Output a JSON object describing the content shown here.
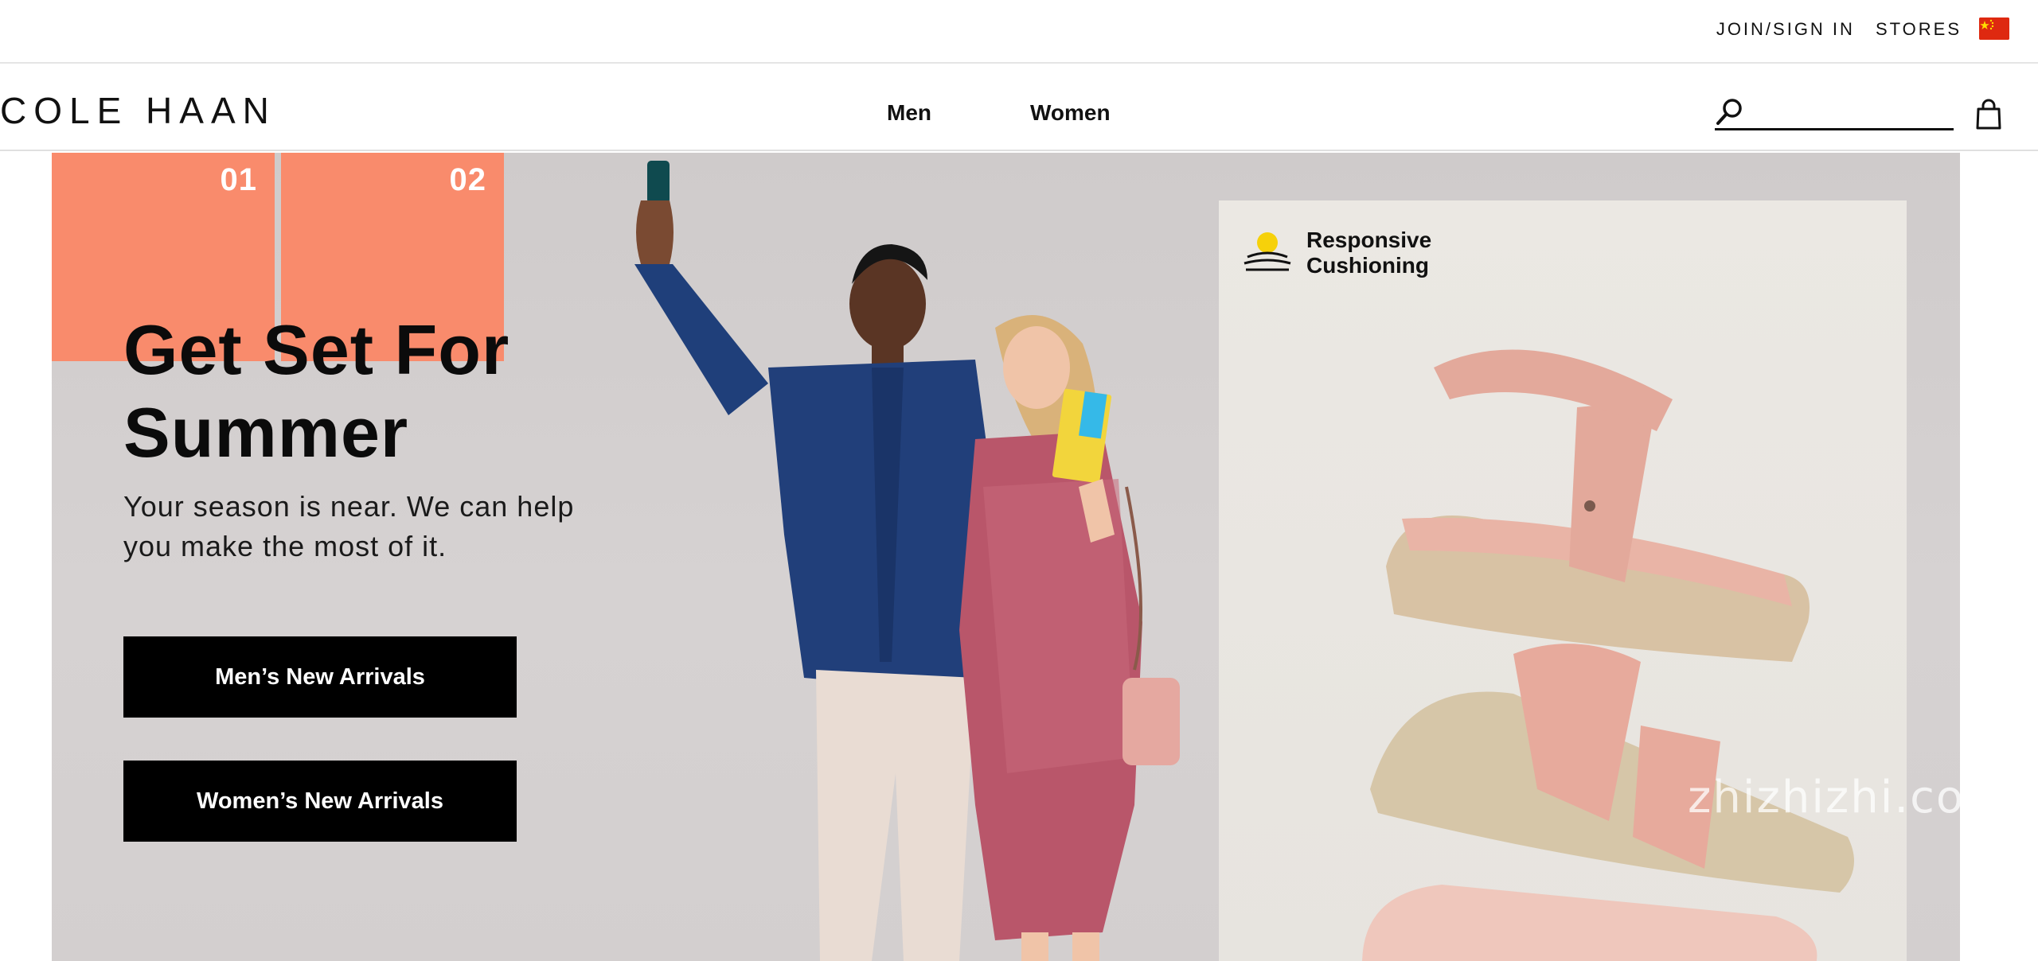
{
  "utility": {
    "join_label": "JOIN/SIGN IN",
    "stores_label": "STORES",
    "flag_icon": "china-flag-icon"
  },
  "header": {
    "logo": "COLE HAAN",
    "nav": [
      "Men",
      "Women"
    ],
    "search": {
      "value": "",
      "placeholder": ""
    }
  },
  "hero": {
    "tabs": [
      "01",
      "02"
    ],
    "title": "Get Set For Summer",
    "subtitle": "Your season is near. We can help you make the most of it.",
    "cta_men": "Men’s New Arrivals",
    "cta_women": "Women’s New Arrivals",
    "feature_line1": "Responsive",
    "feature_line2": "Cushioning"
  },
  "watermark": "zhizhizhi.com",
  "colors": {
    "accent": "#f98b6c",
    "hero_bg": "#d3cfcf",
    "panel_bg": "#e9e6e1",
    "button": "#000000"
  }
}
